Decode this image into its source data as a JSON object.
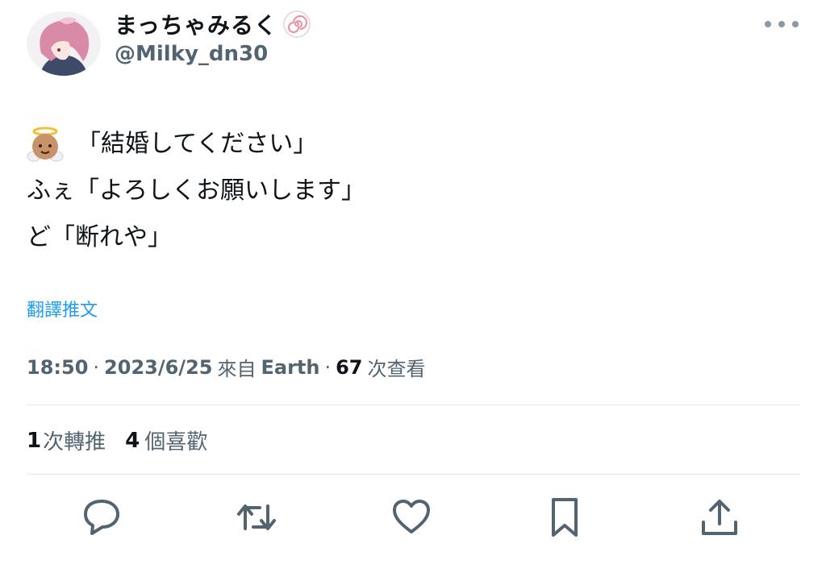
{
  "user": {
    "display_name": "まっちゃみるく",
    "handle": "@Milky_dn30",
    "badge_icon": "naruto-fishcake-icon",
    "avatar_icon": "pink-hair-girl-avatar"
  },
  "tweet": {
    "lines": [
      {
        "emoji": "baby-angel-emoji",
        "text": "「結婚してください」"
      },
      {
        "text": "ふぇ「よろしくお願いします」"
      },
      {
        "text": "ど「断れや」"
      }
    ],
    "translate_label": "翻譯推文"
  },
  "meta": {
    "time": "18:50",
    "dot1": "·",
    "date": "2023/6/25",
    "source_prefix": "來自",
    "source": "Earth",
    "dot2": "·",
    "views_count": "67",
    "views_label": "次查看"
  },
  "stats": {
    "retweets_count": "1",
    "retweets_label": "次轉推",
    "likes_count": "4",
    "likes_label": "個喜歡"
  },
  "actions": [
    "reply-icon",
    "retweet-icon",
    "like-icon",
    "bookmark-icon",
    "share-icon"
  ],
  "colors": {
    "text": "#0f1419",
    "secondary": "#536471",
    "link": "#1d9bf0",
    "divider": "#e1e8ed",
    "icon": "#536471"
  }
}
